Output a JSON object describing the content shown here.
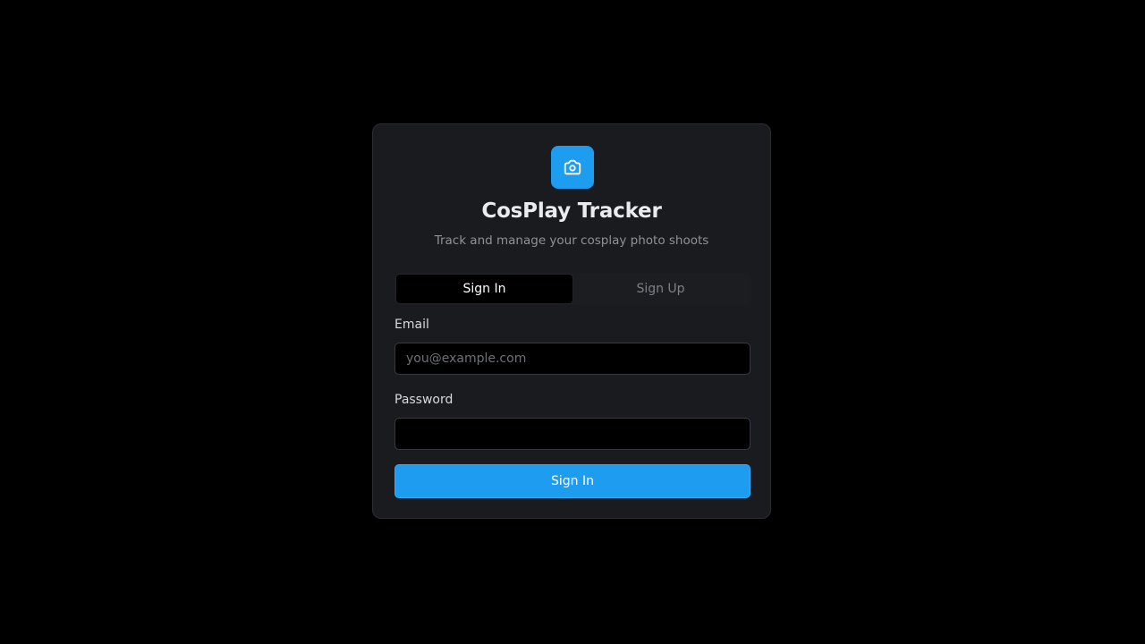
{
  "app": {
    "logo_icon": "camera-icon",
    "title": "CosPlay Tracker",
    "subtitle": "Track and manage your cosplay photo shoots"
  },
  "tabs": [
    {
      "label": "Sign In",
      "active": true
    },
    {
      "label": "Sign Up",
      "active": false
    }
  ],
  "form": {
    "email_label": "Email",
    "email_placeholder": "you@example.com",
    "email_value": "",
    "password_label": "Password",
    "password_value": "",
    "submit_label": "Sign In"
  },
  "colors": {
    "accent": "#1e9cef",
    "background": "#000000",
    "card": "#1a1b1e"
  }
}
